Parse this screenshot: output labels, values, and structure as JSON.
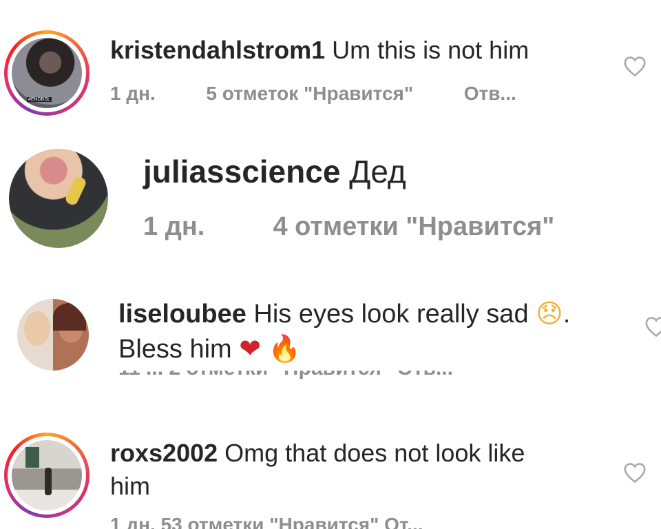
{
  "comments": [
    {
      "username": "kristendahlstrom1",
      "text": "Um this is not him",
      "time": "1 дн.",
      "likes": "5 отметок \"Нравится\"",
      "reply": "Отв...",
      "avatar_badge": "#ENDBSL",
      "has_story_ring": true
    },
    {
      "username": "juliasscience",
      "text": "Дед",
      "time": "1 дн.",
      "likes": "4 отметки \"Нравится\""
    },
    {
      "username": "liseloubee",
      "text_line1": "His eyes look really sad",
      "text_line1_end": ".",
      "text_line2": "Bless him",
      "emoji_sad": "😞",
      "emoji_heart": "❤",
      "emoji_fire": "🔥",
      "meta_cut": "11 ...   2 отметки \"Нравится\"   Отв..."
    },
    {
      "username": "roxs2002",
      "text_line1": "Omg that does not look like",
      "text_line2": "him",
      "meta_cut": "1 дн.     53 отметки \"Нравится\"     От...",
      "has_story_ring": true
    }
  ],
  "icons": {
    "like": "heart-outline-icon"
  },
  "colors": {
    "text": "#262626",
    "secondary": "#8e8e8e",
    "heart": "#a8a8a8"
  }
}
